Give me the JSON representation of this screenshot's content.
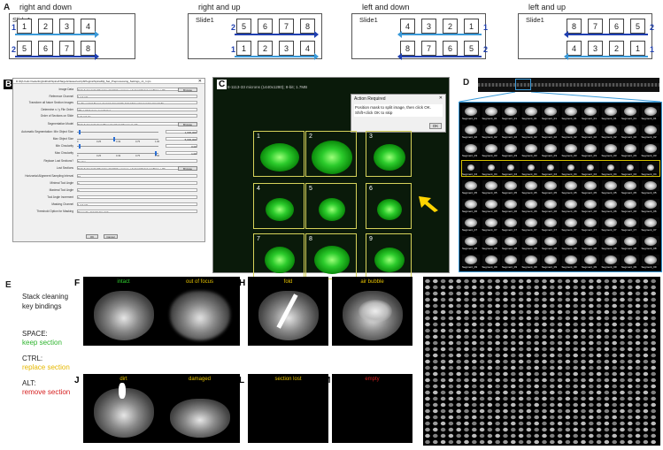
{
  "panel_a": {
    "label": "A",
    "slide_label": "Slide1",
    "sections": [
      {
        "title": "right and down",
        "rows": [
          [
            "1",
            "2",
            "3",
            "4"
          ],
          [
            "5",
            "6",
            "7",
            "8"
          ]
        ],
        "markers": [
          "1",
          "2"
        ]
      },
      {
        "title": "right and up",
        "rows": [
          [
            "5",
            "6",
            "7",
            "8"
          ],
          [
            "1",
            "2",
            "3",
            "4"
          ]
        ],
        "markers": [
          "2",
          "1"
        ]
      },
      {
        "title": "left and down",
        "rows": [
          [
            "4",
            "3",
            "2",
            "1"
          ],
          [
            "8",
            "7",
            "6",
            "5"
          ]
        ],
        "markers": [
          "1",
          "2"
        ]
      },
      {
        "title": "left and up",
        "rows": [
          [
            "8",
            "7",
            "6",
            "5"
          ],
          [
            "4",
            "3",
            "2",
            "1"
          ]
        ],
        "markers": [
          "2",
          "1"
        ]
      }
    ]
  },
  "panel_b": {
    "label": "B",
    "window_title": "D:\\Fiji\\ Felix Fiederling\\Github\\Spinal\\Target\\classes\\script\\Plugins\\Spinal\\fiji_Set_Preprocessing_Settings_v1_1.ijm",
    "fields": [
      {
        "label": "Image Data",
        "value": "D:\\Felix Fiederling\\Postdoc data\\Slide scanner_\\ Analysis\\Spinal cord\\Fixp_i_80",
        "button": "Browse"
      },
      {
        "label": "Reference Channel",
        "value": "1   2   3   4   5"
      },
      {
        "label": "Transform all future Section Images",
        "value": "no flip   vertical flip (up-down)   horizontal flip (left-right)   vertical and horizontal flip"
      },
      {
        "label": "Determine x / y File Order",
        "value": "When HE/2 stage coordinates"
      },
      {
        "label": "Order of Sections on Slide",
        "value": "Left and Up"
      },
      {
        "label": "Segmentation Model",
        "value": "D:\\Felix Fiederling\\tmp\\Procedure\\Spinal\\Segment.pdb",
        "button": "Browse"
      },
      {
        "label": "Automatic Segmentation: Min Object Size",
        "value": "1,000,000"
      },
      {
        "label": "Max Object Size",
        "value": "5,000,000"
      },
      {
        "label": "Min Circularity",
        "value": "0.00"
      },
      {
        "label": "Max Circularity",
        "value": "1.00"
      },
      {
        "label": "Replace Lost Sections?",
        "value": "No   Yes"
      },
      {
        "label": "Lost Sections",
        "value": "D:\\Felix Fiederling\\Postdoc data\\Slide scanner_\\ Analysis\\Spinal cord\\Fixp_i_80",
        "button": "Browse"
      },
      {
        "label": "Horizontal Alignment Sampling Interval",
        "value": "10"
      },
      {
        "label": "Minimal Tool Angle",
        "value": "0"
      },
      {
        "label": "Maximal Tool Angle",
        "value": "0"
      },
      {
        "label": "Tool Angle Increment",
        "value": "0"
      },
      {
        "label": "Masking Channel",
        "value": "1   2   3   4   5"
      },
      {
        "label": "Threshold Option for Masking",
        "value": "Percentile dark   Median dark"
      }
    ],
    "slider_ticks": [
      "0",
      "0.25",
      "0.49",
      "0.75",
      "1.00"
    ],
    "ok": "OK",
    "cancel": "Cancel"
  },
  "panel_c": {
    "label": "C",
    "header": "8-1113-33 microns (1440x1280); 8-bit; 1.7MB",
    "dialog_title": "Action Required",
    "dialog_text": "Position mask to split image, then click OK. Shift+click OK to skip",
    "dialog_ok": "OK",
    "tiles": [
      "1",
      "2",
      "3",
      "4",
      "5",
      "6",
      "7",
      "8",
      "9"
    ]
  },
  "panel_d": {
    "label": "D",
    "rows": [
      "Segment_01",
      "Segment_02",
      "Segment_03",
      "Segment_04",
      "Segment_05",
      "Segment_06",
      "Segment_07",
      "Segment_08",
      "Segment_09"
    ]
  },
  "panel_e": {
    "label": "E",
    "title": "Stack cleaning key bindings",
    "bindings": [
      {
        "key": "SPACE:",
        "action": "keep section",
        "color": "#2fb52f"
      },
      {
        "key": "CTRL:",
        "action": "replace section",
        "color": "#e6b800"
      },
      {
        "key": "ALT:",
        "action": "remove section",
        "color": "#d62020"
      }
    ]
  },
  "tiles_fm": [
    {
      "label": "F",
      "caption": "intact",
      "color": "#2fd12f"
    },
    {
      "label": "G",
      "caption": "out of focus",
      "color": "#e6c200"
    },
    {
      "label": "H",
      "caption": "fold",
      "color": "#e6c200"
    },
    {
      "label": "I",
      "caption": "air bubble",
      "color": "#e6c200"
    },
    {
      "label": "J",
      "caption": "dirt",
      "color": "#e6c200"
    },
    {
      "label": "K",
      "caption": "damaged",
      "color": "#e6c200"
    },
    {
      "label": "L",
      "caption": "section lost",
      "color": "#e6c200"
    },
    {
      "label": "M",
      "caption": "empty",
      "color": "#d62020"
    }
  ],
  "panel_n": {
    "label": "N"
  },
  "colors": {
    "arrow_light": "#3a9ad9",
    "arrow_dark": "#1f3fb0",
    "tissue_green": "#2ccc2c",
    "frame_yellow": "#d6d25a"
  }
}
